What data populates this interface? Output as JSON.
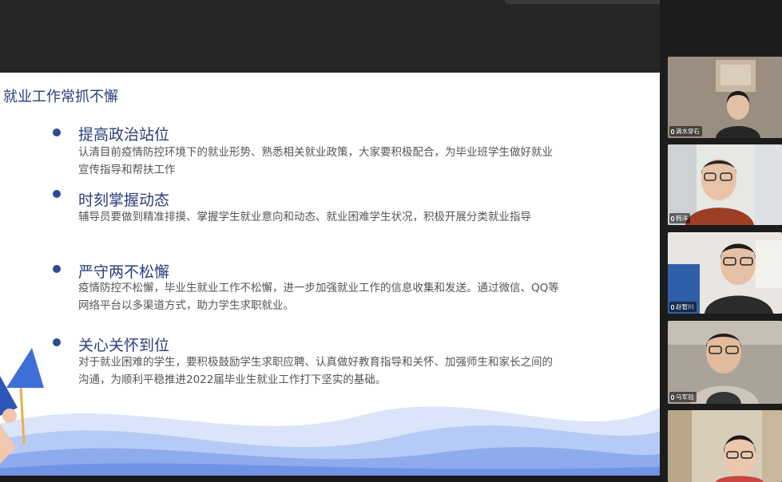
{
  "slide": {
    "title": "就业工作常抓不懈",
    "bullets": [
      {
        "heading": "提高政治站位",
        "body": "认清目前疫情防控环境下的就业形势、熟悉相关就业政策，大家要积极配合，为毕业班学生做好就业宣传指导和帮扶工作"
      },
      {
        "heading": "时刻掌握动态",
        "body": "辅导员要做到精准排摸、掌握学生就业意向和动态、就业困难学生状况，积极开展分类就业指导"
      },
      {
        "heading": "严守两不松懈",
        "body": "疫情防控不松懈，毕业生就业工作不松懈，进一步加强就业工作的信息收集和发送。通过微信、QQ等网络平台以多渠道方式，助力学生求职就业。"
      },
      {
        "heading": "关心关怀到位",
        "body": "对于就业困难的学生，要积极鼓励学生求职应聘、认真做好教育指导和关怀、加强师生和家长之间的沟通，为顺利平稳推进2022届毕业生就业工作打下坚实的基础。"
      }
    ]
  },
  "participants": [
    {
      "name": "滴水穿石"
    },
    {
      "name": "韩洋"
    },
    {
      "name": "赵智川"
    },
    {
      "name": "马军冠"
    },
    {
      "name": ""
    }
  ],
  "colors": {
    "slide_heading": "#2a3f7a",
    "bullet_dot": "#2f4a8f",
    "wave_light": "#c9d8f7",
    "wave_mid": "#9fbaf0",
    "wave_dark": "#6f94e6"
  }
}
